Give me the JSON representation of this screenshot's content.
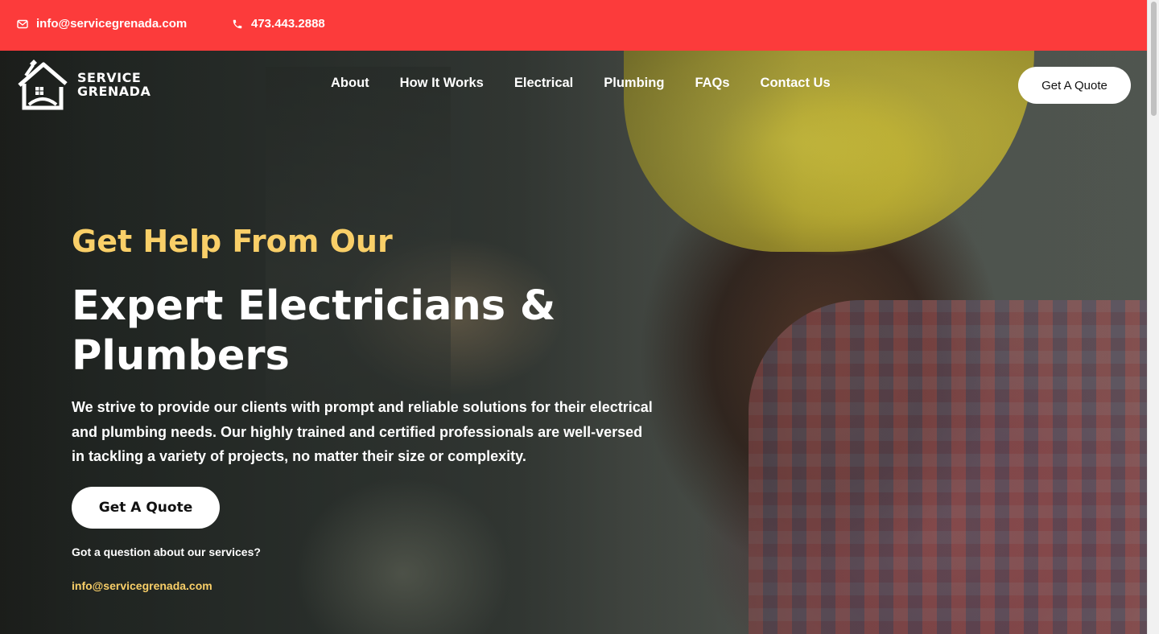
{
  "topbar": {
    "email": "info@servicegrenada.com",
    "phone": "473.443.2888"
  },
  "logo": {
    "line1": "SERVICE",
    "line2": "GRENADA"
  },
  "nav": {
    "items": [
      {
        "label": "About"
      },
      {
        "label": "How It Works"
      },
      {
        "label": "Electrical"
      },
      {
        "label": "Plumbing"
      },
      {
        "label": "FAQs"
      },
      {
        "label": "Contact Us"
      }
    ],
    "quote_label": "Get A Quote"
  },
  "hero": {
    "kicker": "Get Help From Our",
    "headline": "Expert Electricians & Plumbers",
    "description": "We strive to provide our clients with prompt and reliable solutions for their electrical and plumbing needs. Our highly trained and certified professionals are well-versed in tackling a variety of projects, no matter their size or complexity.",
    "quote_label": "Get A Quote",
    "question": "Got a question about our services?",
    "email": "info@servicegrenada.com"
  },
  "colors": {
    "topbar": "#fc3b3b",
    "accent": "#f9cf68",
    "button_bg": "#ffffff"
  }
}
